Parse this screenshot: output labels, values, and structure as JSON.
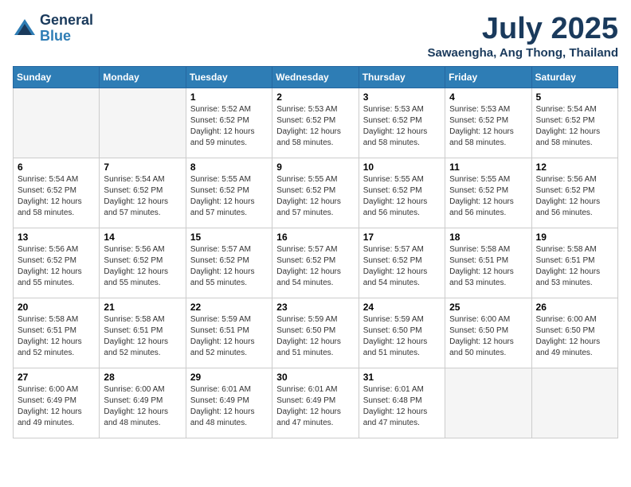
{
  "header": {
    "logo_line1": "General",
    "logo_line2": "Blue",
    "month": "July 2025",
    "location": "Sawaengha, Ang Thong, Thailand"
  },
  "days_of_week": [
    "Sunday",
    "Monday",
    "Tuesday",
    "Wednesday",
    "Thursday",
    "Friday",
    "Saturday"
  ],
  "weeks": [
    [
      {
        "num": "",
        "info": ""
      },
      {
        "num": "",
        "info": ""
      },
      {
        "num": "1",
        "info": "Sunrise: 5:52 AM\nSunset: 6:52 PM\nDaylight: 12 hours and 59 minutes."
      },
      {
        "num": "2",
        "info": "Sunrise: 5:53 AM\nSunset: 6:52 PM\nDaylight: 12 hours and 58 minutes."
      },
      {
        "num": "3",
        "info": "Sunrise: 5:53 AM\nSunset: 6:52 PM\nDaylight: 12 hours and 58 minutes."
      },
      {
        "num": "4",
        "info": "Sunrise: 5:53 AM\nSunset: 6:52 PM\nDaylight: 12 hours and 58 minutes."
      },
      {
        "num": "5",
        "info": "Sunrise: 5:54 AM\nSunset: 6:52 PM\nDaylight: 12 hours and 58 minutes."
      }
    ],
    [
      {
        "num": "6",
        "info": "Sunrise: 5:54 AM\nSunset: 6:52 PM\nDaylight: 12 hours and 58 minutes."
      },
      {
        "num": "7",
        "info": "Sunrise: 5:54 AM\nSunset: 6:52 PM\nDaylight: 12 hours and 57 minutes."
      },
      {
        "num": "8",
        "info": "Sunrise: 5:55 AM\nSunset: 6:52 PM\nDaylight: 12 hours and 57 minutes."
      },
      {
        "num": "9",
        "info": "Sunrise: 5:55 AM\nSunset: 6:52 PM\nDaylight: 12 hours and 57 minutes."
      },
      {
        "num": "10",
        "info": "Sunrise: 5:55 AM\nSunset: 6:52 PM\nDaylight: 12 hours and 56 minutes."
      },
      {
        "num": "11",
        "info": "Sunrise: 5:55 AM\nSunset: 6:52 PM\nDaylight: 12 hours and 56 minutes."
      },
      {
        "num": "12",
        "info": "Sunrise: 5:56 AM\nSunset: 6:52 PM\nDaylight: 12 hours and 56 minutes."
      }
    ],
    [
      {
        "num": "13",
        "info": "Sunrise: 5:56 AM\nSunset: 6:52 PM\nDaylight: 12 hours and 55 minutes."
      },
      {
        "num": "14",
        "info": "Sunrise: 5:56 AM\nSunset: 6:52 PM\nDaylight: 12 hours and 55 minutes."
      },
      {
        "num": "15",
        "info": "Sunrise: 5:57 AM\nSunset: 6:52 PM\nDaylight: 12 hours and 55 minutes."
      },
      {
        "num": "16",
        "info": "Sunrise: 5:57 AM\nSunset: 6:52 PM\nDaylight: 12 hours and 54 minutes."
      },
      {
        "num": "17",
        "info": "Sunrise: 5:57 AM\nSunset: 6:52 PM\nDaylight: 12 hours and 54 minutes."
      },
      {
        "num": "18",
        "info": "Sunrise: 5:58 AM\nSunset: 6:51 PM\nDaylight: 12 hours and 53 minutes."
      },
      {
        "num": "19",
        "info": "Sunrise: 5:58 AM\nSunset: 6:51 PM\nDaylight: 12 hours and 53 minutes."
      }
    ],
    [
      {
        "num": "20",
        "info": "Sunrise: 5:58 AM\nSunset: 6:51 PM\nDaylight: 12 hours and 52 minutes."
      },
      {
        "num": "21",
        "info": "Sunrise: 5:58 AM\nSunset: 6:51 PM\nDaylight: 12 hours and 52 minutes."
      },
      {
        "num": "22",
        "info": "Sunrise: 5:59 AM\nSunset: 6:51 PM\nDaylight: 12 hours and 52 minutes."
      },
      {
        "num": "23",
        "info": "Sunrise: 5:59 AM\nSunset: 6:50 PM\nDaylight: 12 hours and 51 minutes."
      },
      {
        "num": "24",
        "info": "Sunrise: 5:59 AM\nSunset: 6:50 PM\nDaylight: 12 hours and 51 minutes."
      },
      {
        "num": "25",
        "info": "Sunrise: 6:00 AM\nSunset: 6:50 PM\nDaylight: 12 hours and 50 minutes."
      },
      {
        "num": "26",
        "info": "Sunrise: 6:00 AM\nSunset: 6:50 PM\nDaylight: 12 hours and 49 minutes."
      }
    ],
    [
      {
        "num": "27",
        "info": "Sunrise: 6:00 AM\nSunset: 6:49 PM\nDaylight: 12 hours and 49 minutes."
      },
      {
        "num": "28",
        "info": "Sunrise: 6:00 AM\nSunset: 6:49 PM\nDaylight: 12 hours and 48 minutes."
      },
      {
        "num": "29",
        "info": "Sunrise: 6:01 AM\nSunset: 6:49 PM\nDaylight: 12 hours and 48 minutes."
      },
      {
        "num": "30",
        "info": "Sunrise: 6:01 AM\nSunset: 6:49 PM\nDaylight: 12 hours and 47 minutes."
      },
      {
        "num": "31",
        "info": "Sunrise: 6:01 AM\nSunset: 6:48 PM\nDaylight: 12 hours and 47 minutes."
      },
      {
        "num": "",
        "info": ""
      },
      {
        "num": "",
        "info": ""
      }
    ]
  ]
}
